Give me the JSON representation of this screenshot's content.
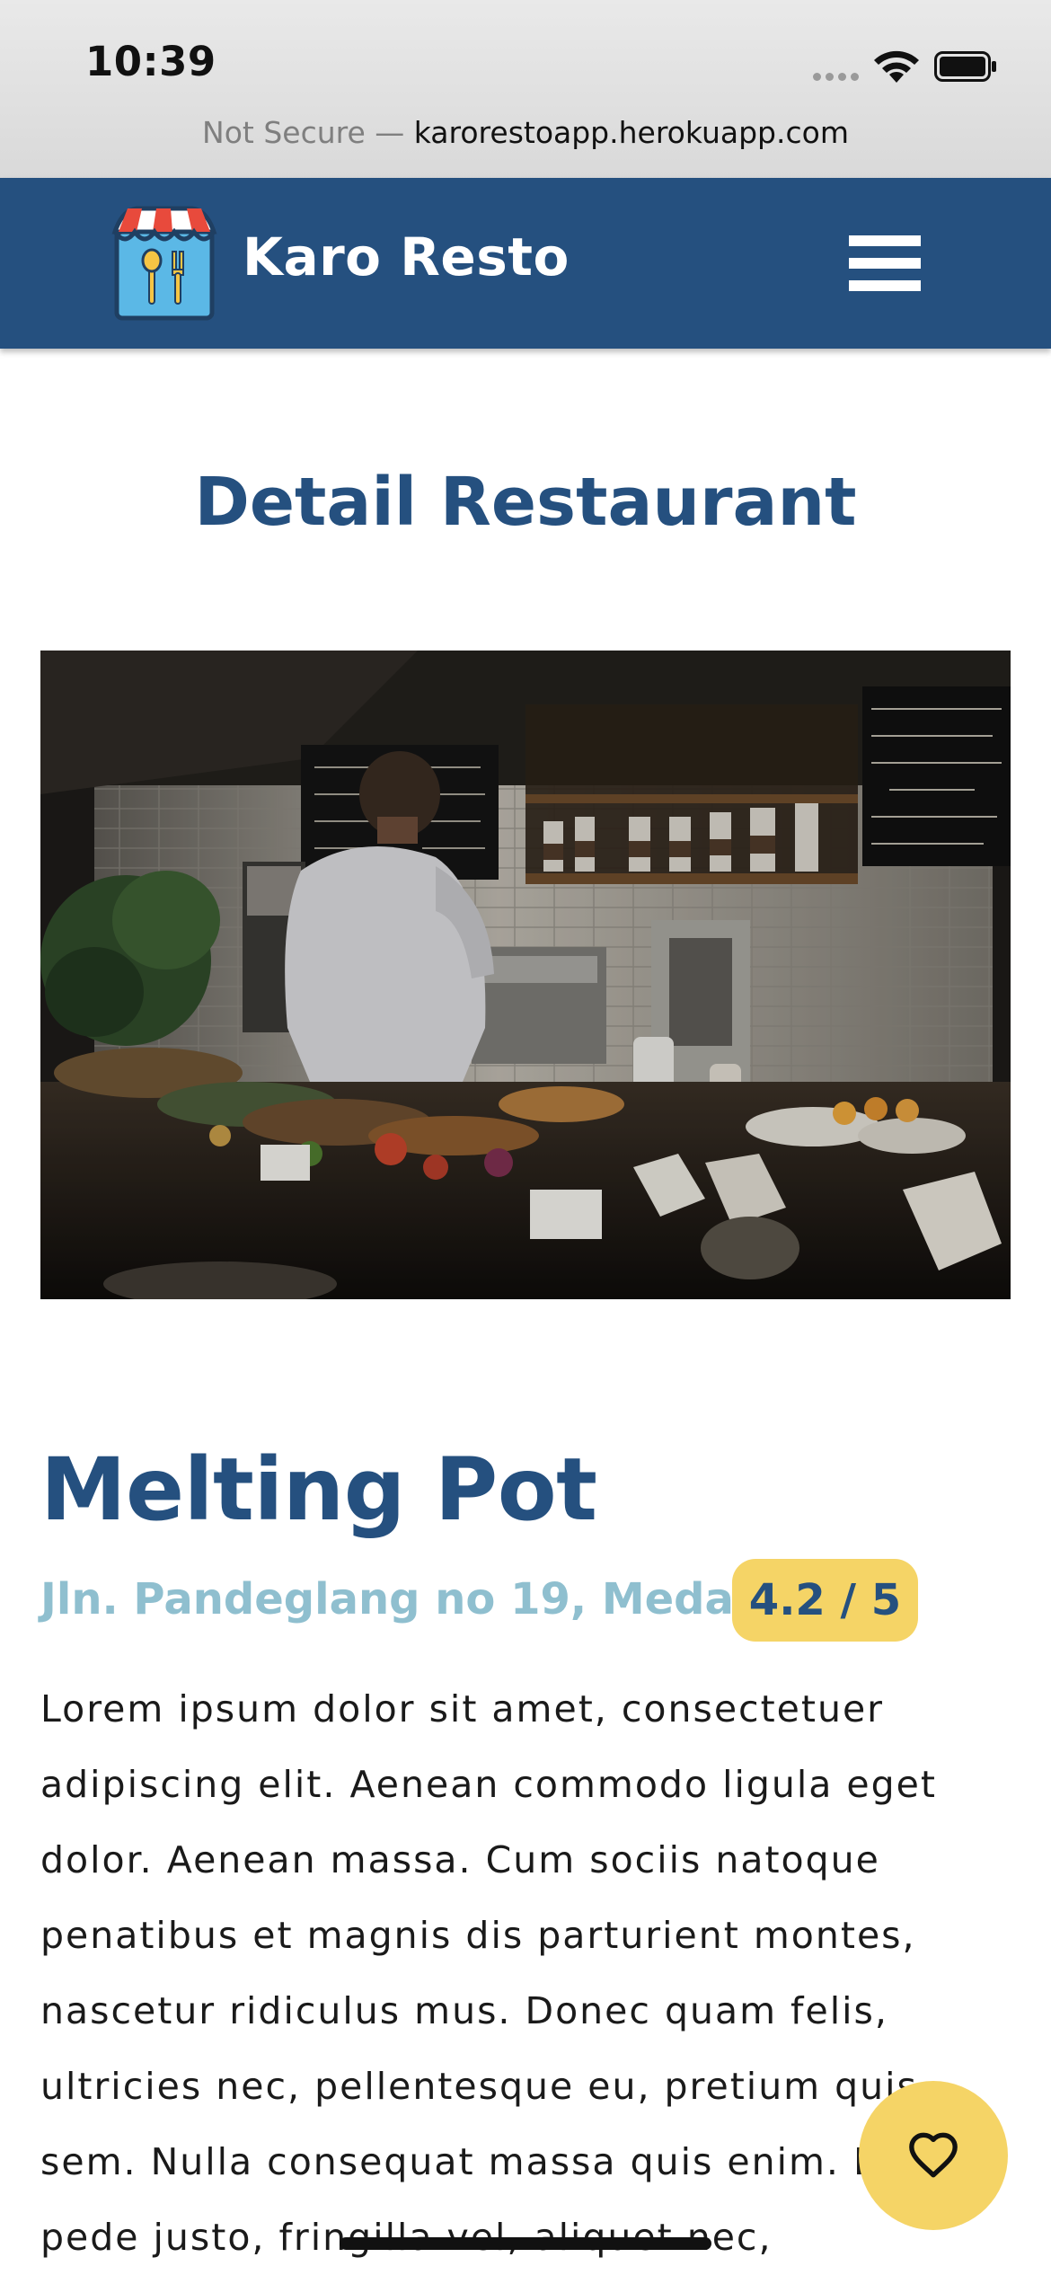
{
  "status_bar": {
    "time": "10:39",
    "url_prefix": "Not Secure — ",
    "url_domain": "karorestoapp.herokuapp.com"
  },
  "app_bar": {
    "brand": "Karo Resto",
    "logo_icon": "store-icon",
    "menu_icon": "hamburger-menu-icon",
    "color": "#25507f"
  },
  "page": {
    "title": "Detail Restaurant"
  },
  "restaurant": {
    "name": "Melting Pot",
    "address": "Jln. Pandeglang no 19, Medan",
    "rating": "4.2 / 5",
    "description": "Lorem ipsum dolor sit amet, consectetuer adipiscing elit. Aenean commodo ligula eget dolor. Aenean massa. Cum sociis natoque penatibus et magnis dis parturient montes, nascetur ridiculus mus. Donec quam felis, ultricies nec, pellentesque eu, pretium quis, sem. Nulla consequat massa quis enim. Donec pede justo, fringilla vel, aliquet nec,"
  },
  "favorite_button": {
    "icon": "heart-icon",
    "color": "#f5d466"
  },
  "colors": {
    "primary": "#25507f",
    "accent": "#f5d466",
    "address": "#8fbfcf"
  }
}
